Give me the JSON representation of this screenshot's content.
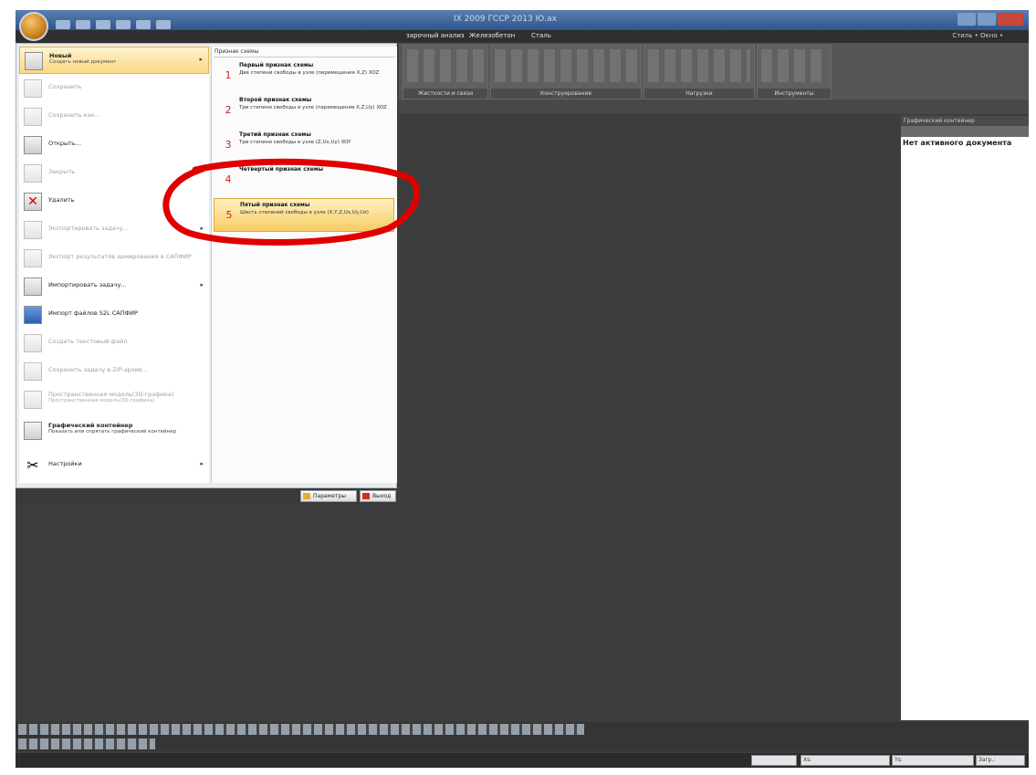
{
  "window": {
    "title": "IX 2009 ГССР 2013 Ю.ах",
    "colors": {
      "accent": "#f8cc63",
      "highlight_oval": "#e00000",
      "workspace": "#3d3d3d"
    }
  },
  "menubar": {
    "tabs": [
      "зарочный анализ",
      "Железобетон",
      "Сталь"
    ],
    "right": "Стиль • Окно •"
  },
  "ribbon": {
    "groups": [
      "Жесткости и связи",
      "Конструирование",
      "Нагрузки",
      "Инструменты"
    ]
  },
  "graphics_panel": {
    "title": "Графический контейнер",
    "empty_text": "Нет активного документа"
  },
  "app_menu": {
    "items": [
      {
        "icon": "new-document-icon",
        "label": "Новый",
        "sub": "Создать новый документ",
        "active": true,
        "submenu": true
      },
      {
        "icon": "save-icon",
        "label": "Сохранить",
        "dim": true
      },
      {
        "icon": "save-as-icon",
        "label": "Сохранить как...",
        "dim": true
      },
      {
        "icon": "open-icon",
        "label": "Открыть..."
      },
      {
        "icon": "close-document-icon",
        "label": "Закрыть",
        "dim": true
      },
      {
        "icon": "delete-icon",
        "label": "Удалить"
      },
      {
        "icon": "export-task-icon",
        "label": "Экспортировать задачу...",
        "dim": true,
        "submenu": true
      },
      {
        "icon": "export-results-icon",
        "label": "Экспорт результатов армирования в САПФИР",
        "dim": true
      },
      {
        "icon": "import-task-icon",
        "label": "Импортировать задачу...",
        "submenu": true
      },
      {
        "icon": "import-s2l-icon",
        "label": "Импорт файлов S2L САПФИР"
      },
      {
        "icon": "text-file-icon",
        "label": "Создать текстовый файл",
        "dim": true
      },
      {
        "icon": "zip-archive-icon",
        "label": "Сохранить задачу в ZIP-архив...",
        "dim": true
      },
      {
        "icon": "3d-model-icon",
        "label": "Пространственная модель(3D-графика)",
        "sub": "Пространственная модель(3D-графика)",
        "dim": true
      },
      {
        "icon": "graphics-container-icon",
        "label": "Графический контейнер",
        "sub": "Показать или спрятать графический контейнер"
      },
      {
        "icon": "settings-icon",
        "label": "Настройки",
        "submenu": true
      }
    ],
    "right_header": "Признак схемы",
    "schemes": [
      {
        "num": "1",
        "title": "Первый признак схемы",
        "desc": "Две степени свободы в узле (перемещения X,Z) XOZ"
      },
      {
        "num": "2",
        "title": "Второй признак схемы",
        "desc": "Три степени свободы в узле (перемещения X,Z,Uy) XOZ"
      },
      {
        "num": "3",
        "title": "Третий признак схемы",
        "desc": "Три степени свободы в узле (Z,Ux,Uy) XOY"
      },
      {
        "num": "4",
        "title": "Четвертый признак схемы",
        "desc": ""
      },
      {
        "num": "5",
        "title": "Пятый признак схемы",
        "desc": "Шесть степеней свободы в узле (X,Y,Z,Ux,Uy,Uz)",
        "active": true
      }
    ],
    "footer": {
      "params": "Параметры",
      "exit": "Выход"
    }
  },
  "status_bar": {
    "cells": [
      "Xs:",
      "Ys:",
      "Загр.:"
    ]
  }
}
